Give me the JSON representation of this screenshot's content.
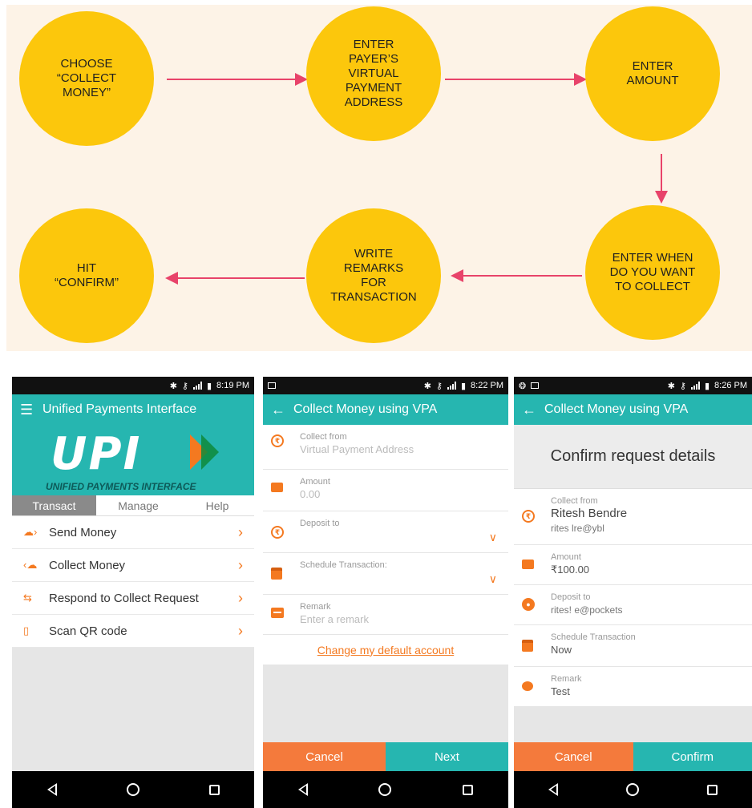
{
  "flow": {
    "steps": [
      "CHOOSE\n“COLLECT\nMONEY”",
      "ENTER\nPAYER’S\nVIRTUAL\nPAYMENT\nADDRESS",
      "ENTER\nAMOUNT",
      "ENTER WHEN\nDO YOU WANT\nTO COLLECT",
      "WRITE\nREMARKS\nFOR\nTRANSACTION",
      "HIT\n“CONFIRM”"
    ],
    "colors": {
      "circle": "#fcc70c",
      "arrow": "#e8436a",
      "background": "#fdf3e7"
    }
  },
  "screen1": {
    "status_time": "8:19 PM",
    "title": "Unified Payments Interface",
    "logo_text": "UPI",
    "logo_subtitle": "UNIFIED PAYMENTS INTERFACE",
    "tabs": [
      "Transact",
      "Manage",
      "Help"
    ],
    "menu": [
      {
        "label": "Send Money",
        "icon": "send-money-icon"
      },
      {
        "label": "Collect Money",
        "icon": "collect-money-icon"
      },
      {
        "label": "Respond to Collect Request",
        "icon": "respond-request-icon"
      },
      {
        "label": "Scan QR code",
        "icon": "qr-code-icon"
      }
    ]
  },
  "screen2": {
    "status_time": "8:22 PM",
    "title": "Collect Money using VPA",
    "fields": {
      "collect_from": {
        "label": "Collect from",
        "placeholder": "Virtual Payment Address"
      },
      "amount": {
        "label": "Amount",
        "placeholder": "0.00"
      },
      "deposit_to": {
        "label": "Deposit to"
      },
      "schedule": {
        "label": "Schedule Transaction:"
      },
      "remark": {
        "label": "Remark",
        "placeholder": "Enter a remark"
      }
    },
    "link": "Change my default account",
    "cancel": "Cancel",
    "next": "Next"
  },
  "screen3": {
    "status_time": "8:26 PM",
    "title": "Collect Money using VPA",
    "heading": "Confirm request details",
    "collect_from": {
      "label": "Collect from",
      "name": "Ritesh Bendre",
      "vpa": "rites      lre@ybl"
    },
    "amount": {
      "label": "Amount",
      "value": "₹100.00"
    },
    "deposit_to": {
      "label": "Deposit to",
      "value": "rites!         e@pockets"
    },
    "schedule": {
      "label": "Schedule Transaction",
      "value": "Now"
    },
    "remark": {
      "label": "Remark",
      "value": "Test"
    },
    "cancel": "Cancel",
    "confirm": "Confirm"
  },
  "colors": {
    "teal": "#26b6b0",
    "orange": "#f47920"
  }
}
